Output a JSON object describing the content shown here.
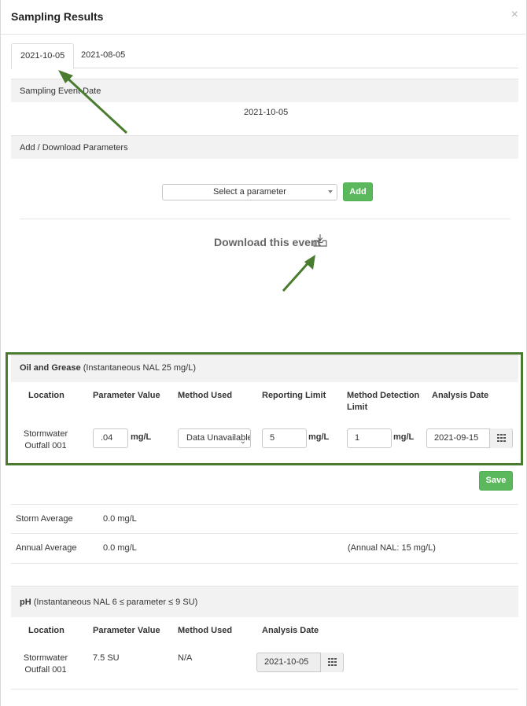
{
  "modal": {
    "title": "Sampling Results",
    "close": "×"
  },
  "tabs": [
    {
      "label": "2021-10-05"
    },
    {
      "label": "2021-08-05"
    }
  ],
  "event": {
    "band_label": "Sampling Event Date",
    "date": "2021-10-05"
  },
  "params": {
    "band_label": "Add / Download Parameters",
    "select_placeholder": "Select a parameter",
    "add_label": "Add",
    "download_label": "Download this event"
  },
  "oil": {
    "title": "Oil and Grease",
    "subtitle": " (Instantaneous NAL 25 mg/L)",
    "headers": {
      "location": "Location",
      "value": "Parameter Value",
      "method": "Method Used",
      "reporting": "Reporting Limit",
      "detection": "Method Detection Limit",
      "analysis": "Analysis Date"
    },
    "row": {
      "location": "Stormwater Outfall 001",
      "value": ".04",
      "value_unit": "mg/L",
      "method": "Data Unavailable",
      "reporting": "5",
      "reporting_unit": "mg/L",
      "detection": "1",
      "detection_unit": "mg/L",
      "analysis_date": "2021-09-15"
    },
    "save_label": "Save",
    "storm_avg_label": "Storm Average",
    "storm_avg_value": "0.0 mg/L",
    "annual_avg_label": "Annual Average",
    "annual_avg_value": "0.0 mg/L",
    "annual_nal": "(Annual NAL: 15 mg/L)"
  },
  "ph": {
    "title": "pH",
    "subtitle": " (Instantaneous NAL 6 ≤ parameter ≤ 9 SU)",
    "headers": {
      "location": "Location",
      "value": "Parameter Value",
      "method": "Method Used",
      "analysis": "Analysis Date"
    },
    "row": {
      "location": "Stormwater Outfall 001",
      "value": "7.5 SU",
      "method": "N/A",
      "analysis_date": "2021-10-05"
    }
  },
  "colors": {
    "accent_green": "#5cb85c",
    "highlight_green": "#4a7c2f",
    "band_gray": "#f2f2f2"
  }
}
